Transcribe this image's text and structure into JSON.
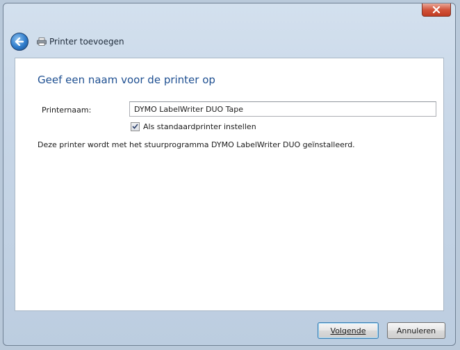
{
  "window": {
    "close_icon": "close-icon"
  },
  "navbar": {
    "back_icon": "back-arrow-icon",
    "wizard_icon": "printer-icon",
    "title": "Printer toevoegen"
  },
  "page": {
    "heading": "Geef een naam voor de printer op",
    "printer_name_label": "Printernaam:",
    "printer_name_value": "DYMO LabelWriter DUO Tape",
    "set_default_label": "Als standaardprinter instellen",
    "set_default_checked": true,
    "info_text": "Deze printer wordt met het stuurprogramma DYMO LabelWriter DUO geïnstalleerd."
  },
  "footer": {
    "next_label": "Volgende",
    "cancel_label": "Annuleren"
  },
  "colors": {
    "heading": "#1e4f91",
    "close_button": "#c13b22",
    "chrome": "#c7d6e7"
  }
}
